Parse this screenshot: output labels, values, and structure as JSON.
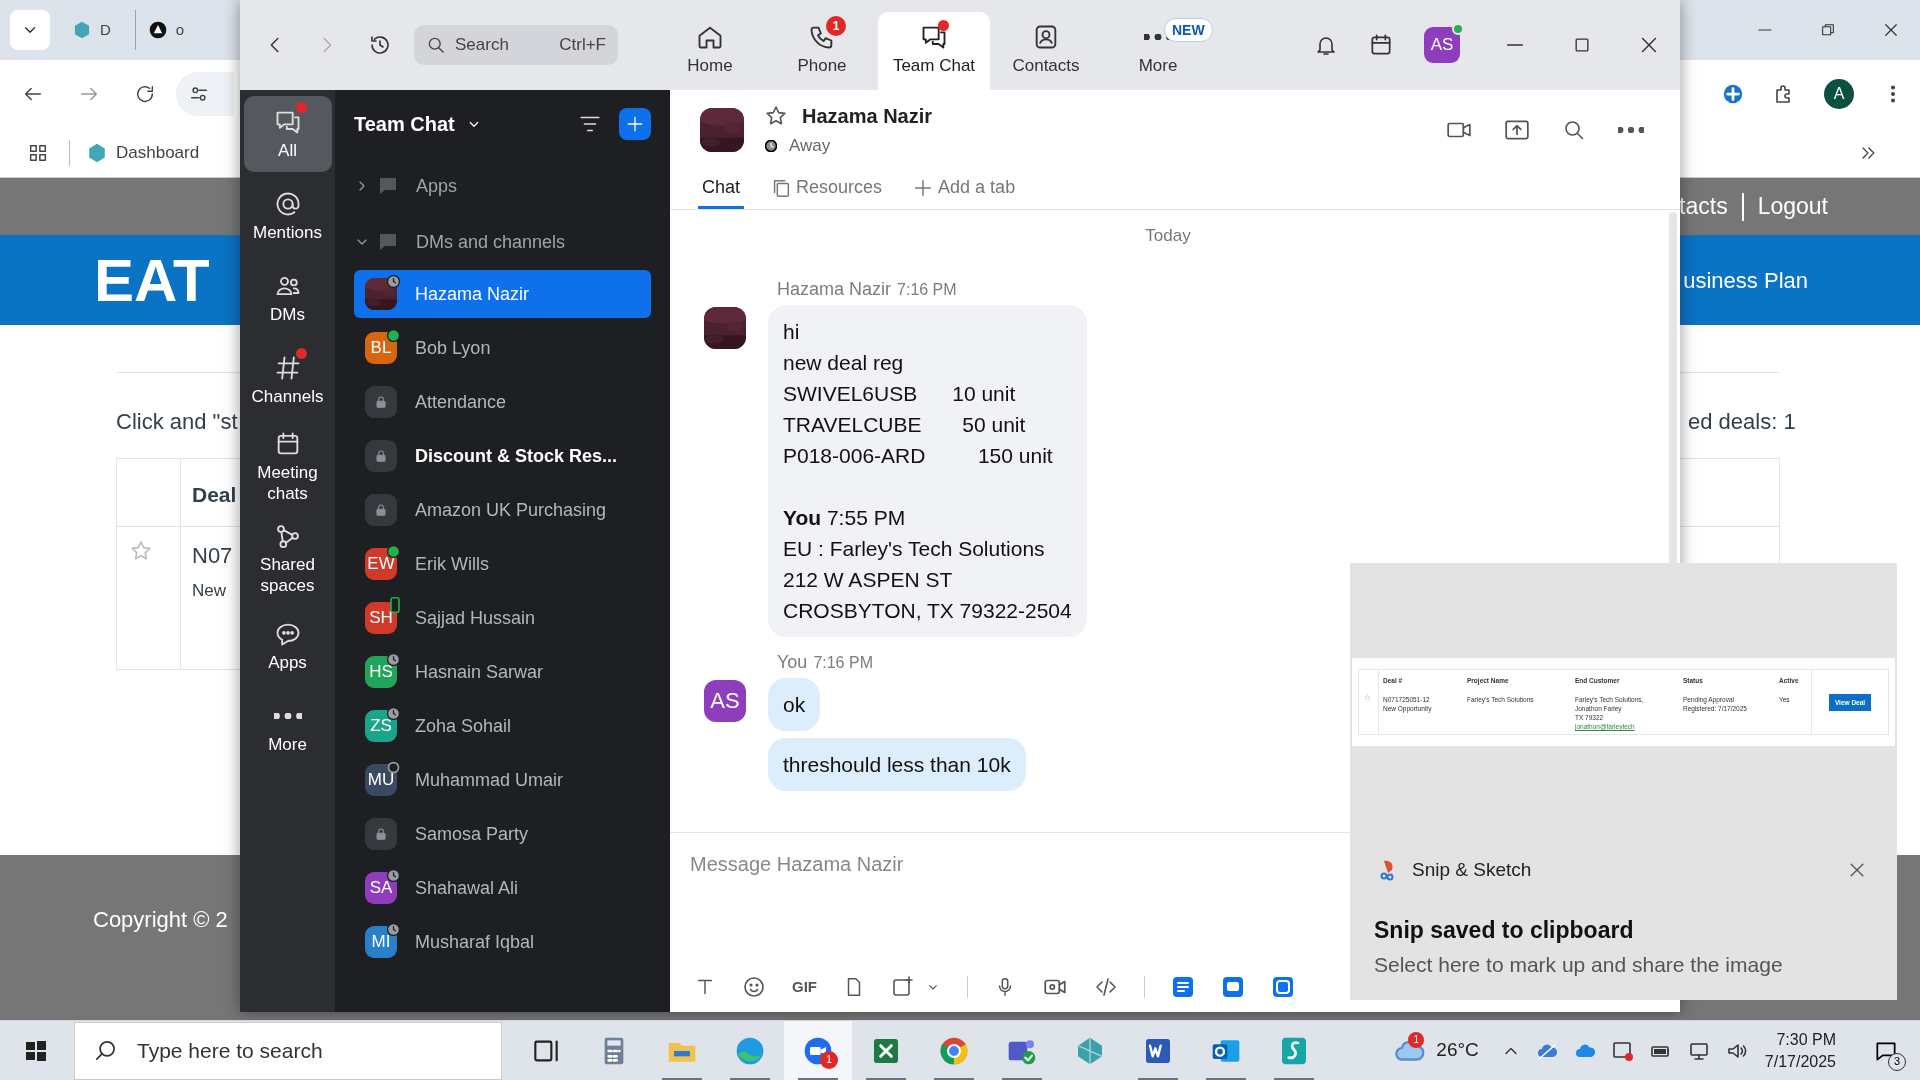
{
  "browser": {
    "tabs": [
      {
        "label": "D"
      },
      {
        "label": "o"
      }
    ],
    "bookmark": "Dashboard",
    "profile": "A",
    "page": {
      "nav_links": [
        "tacts",
        "Logout"
      ],
      "logo": "EAT",
      "banner_link": "usiness Plan",
      "intro": "Click and \"st",
      "deals_count": "ed deals: 1",
      "table_header": "Deal",
      "row_deal": "N07",
      "row_type": "New",
      "footer": "Copyright © 2"
    }
  },
  "zoom": {
    "search": {
      "placeholder": "Search",
      "shortcut": "Ctrl+F"
    },
    "nav": [
      {
        "label": "Home",
        "selected": false,
        "dot": false
      },
      {
        "label": "Phone",
        "selected": false,
        "dot": false,
        "badge": "1"
      },
      {
        "label": "Team Chat",
        "selected": true,
        "dot": true
      },
      {
        "label": "Contacts",
        "selected": false,
        "dot": false
      },
      {
        "label": "More",
        "selected": false,
        "dot": false,
        "tag": "NEW"
      }
    ],
    "user": {
      "initials": "AS",
      "color": "#8e3dbd",
      "online": true
    },
    "rail": [
      {
        "label": "All",
        "selected": true,
        "dot": true
      },
      {
        "label": "Mentions",
        "selected": false,
        "dot": false
      },
      {
        "label": "DMs",
        "selected": false,
        "dot": false
      },
      {
        "label": "Channels",
        "selected": false,
        "dot": true
      },
      {
        "label": "Meeting chats",
        "selected": false,
        "dot": false
      },
      {
        "label": "Shared spaces",
        "selected": false,
        "dot": false
      },
      {
        "label": "Apps",
        "selected": false,
        "dot": false
      },
      {
        "label": "More",
        "selected": false,
        "dot": false
      }
    ],
    "list": {
      "title": "Team Chat",
      "sections": [
        {
          "label": "Apps",
          "expanded": false
        },
        {
          "label": "DMs and channels",
          "expanded": true
        }
      ],
      "items": [
        {
          "name": "Hazama Nazir",
          "kind": "picture",
          "away": true,
          "online": false,
          "mobile": false,
          "selected": true,
          "unread": false
        },
        {
          "name": "Bob Lyon",
          "kind": "initials",
          "initials": "BL",
          "color": "#d9650f",
          "away": false,
          "online": true,
          "mobile": false,
          "selected": false,
          "unread": false
        },
        {
          "name": "Attendance",
          "kind": "channel",
          "selected": false,
          "unread": false
        },
        {
          "name": "Discount & Stock Res...",
          "kind": "channel",
          "selected": false,
          "unread": true
        },
        {
          "name": "Amazon UK Purchasing",
          "kind": "channel",
          "selected": false,
          "unread": false
        },
        {
          "name": "Erik Wills",
          "kind": "initials",
          "initials": "EW",
          "color": "#cf3a2a",
          "away": false,
          "online": true,
          "mobile": false,
          "selected": false,
          "unread": false
        },
        {
          "name": "Sajjad Hussain",
          "kind": "initials",
          "initials": "SH",
          "color": "#cf3a2a",
          "away": false,
          "online": false,
          "mobile": true,
          "selected": false,
          "unread": false
        },
        {
          "name": "Hasnain Sarwar",
          "kind": "initials",
          "initials": "HS",
          "color": "#21a55a",
          "away": true,
          "online": false,
          "mobile": false,
          "selected": false,
          "unread": false
        },
        {
          "name": "Zoha Sohail",
          "kind": "initials",
          "initials": "ZS",
          "color": "#1aa58a",
          "away": true,
          "online": false,
          "mobile": false,
          "selected": false,
          "unread": false
        },
        {
          "name": "Muhammad Umair",
          "kind": "initials",
          "initials": "MU",
          "color": "#3b4a63",
          "away": false,
          "online": false,
          "mobile": false,
          "selected": false,
          "unread": false
        },
        {
          "name": "Samosa Party",
          "kind": "channel",
          "selected": false,
          "unread": false
        },
        {
          "name": "Shahawal Ali",
          "kind": "initials",
          "initials": "SA",
          "color": "#8e3dbd",
          "away": true,
          "online": false,
          "mobile": false,
          "selected": false,
          "unread": false
        },
        {
          "name": "Musharaf Iqbal",
          "kind": "initials",
          "initials": "MI",
          "color": "#2a7fc9",
          "away": true,
          "online": false,
          "mobile": false,
          "selected": false,
          "unread": false
        }
      ]
    },
    "chat": {
      "contact": "Hazama Nazir",
      "status": "Away",
      "starred": false,
      "tabs": [
        {
          "label": "Chat",
          "selected": true
        },
        {
          "label": "Resources",
          "selected": false
        },
        {
          "label": "Add a tab",
          "selected": false
        }
      ],
      "day": "Today",
      "messages": [
        {
          "sender": "Hazama Nazir",
          "time": "7:16 PM",
          "kind": "picture",
          "bubbles": [
            {
              "mine": false,
              "text": "hi\nnew deal reg\nSWIVEL6USB      10 unit\nTRAVELCUBE       50 unit\nP018-006-ARD         150 unit\n\n**You** 7:55 PM\nEU : Farley's Tech Solutions\n212 W ASPEN ST\nCROSBYTON, TX 79322-2504"
            }
          ]
        },
        {
          "sender": "You",
          "time": "7:16 PM",
          "kind": "initials",
          "initials": "AS",
          "color": "#8e3dbd",
          "bubbles": [
            {
              "mine": true,
              "text": "ok"
            },
            {
              "mine": true,
              "text": "threshould less than 10k"
            }
          ]
        }
      ],
      "composer": {
        "placeholder": "Message Hazama Nazir",
        "gif_label": "GIF"
      }
    }
  },
  "toast": {
    "app": "Snip & Sketch",
    "title": "Snip saved to clipboard",
    "body": "Select here to mark up and share the image",
    "preview": {
      "columns": [
        "Deal #",
        "Project Name",
        "End Customer",
        "Status",
        "Active"
      ],
      "cells": [
        [
          "N071725051-12",
          "New Opportunity"
        ],
        [
          "Farley's Tech Solutions"
        ],
        [
          "Farley's Tech Solutions,",
          "Jonathon Farley",
          "TX 79322",
          "jonathon@farleytech"
        ],
        [
          "Pending Approval",
          "Registered: 7/17/2025"
        ],
        [
          "Yes"
        ]
      ],
      "action": "View Deal"
    }
  },
  "taskbar": {
    "search_placeholder": "Type here to search",
    "apps": [
      {
        "running": false,
        "selected": false
      },
      {
        "running": false,
        "selected": false
      },
      {
        "running": true,
        "selected": false
      },
      {
        "running": true,
        "selected": false
      },
      {
        "running": true,
        "selected": true,
        "badge": "1"
      },
      {
        "running": true,
        "selected": false
      },
      {
        "running": true,
        "selected": false
      },
      {
        "running": true,
        "selected": false
      },
      {
        "running": false,
        "selected": false
      },
      {
        "running": true,
        "selected": false
      },
      {
        "running": true,
        "selected": false
      },
      {
        "running": true,
        "selected": false
      }
    ],
    "weather": {
      "temp": "26°C",
      "badge": "1"
    },
    "time": "7:30 PM",
    "date": "7/17/2025",
    "notifications": "3"
  }
}
